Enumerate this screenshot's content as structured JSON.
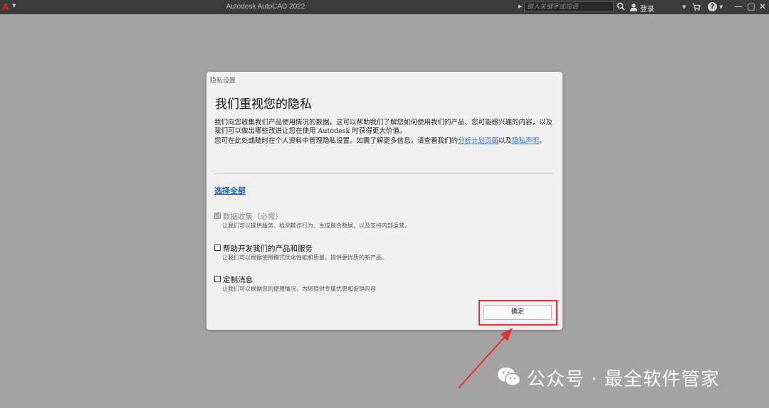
{
  "titlebar": {
    "app_title": "Autodesk AutoCAD 2022",
    "search_placeholder": "键入关键字或短语",
    "login_label": "登录",
    "help_icon_char": "?",
    "window_buttons": [
      "—",
      "□",
      "✕"
    ]
  },
  "dialog": {
    "title": "隐私设置",
    "heading": "我们重视您的隐私",
    "paragraph1": "我们向您收集我们产品使用情况的数据，这可以帮助我们了解您如何使用我们的产品、您可能感兴趣的内容，以及我们可以做出哪些改进让您在使用 Autodesk 时获得更大价值。",
    "paragraph2_prefix": "您可在此处或随时在个人资料中管理隐私设置。如需了解更多信息，请查看我们的",
    "link_analytics": "分析计划页面",
    "paragraph2_middle": "以及",
    "link_privacy": "隐私声明",
    "paragraph2_suffix": "。",
    "select_all": "选择全部",
    "options": [
      {
        "label": "数据收集（必需）",
        "desc": "让我们可以提供服务、检测欺诈行为、生成聚合数据，以及支持内部运营。",
        "checked": true,
        "disabled": true
      },
      {
        "label": "帮助开发我们的产品和服务",
        "desc": "让我们可以根据使用模式优化性能和质量，提供更优质的新产品。",
        "checked": false,
        "disabled": false
      },
      {
        "label": "定制消息",
        "desc": "让我们可以根据您的使用情况，为您提供专属优惠和促销内容",
        "checked": false,
        "disabled": false
      }
    ],
    "ok_label": "确定"
  },
  "annotation": {
    "color": "#e53030"
  },
  "watermark": {
    "text": "公众号 · 最全软件管家"
  }
}
